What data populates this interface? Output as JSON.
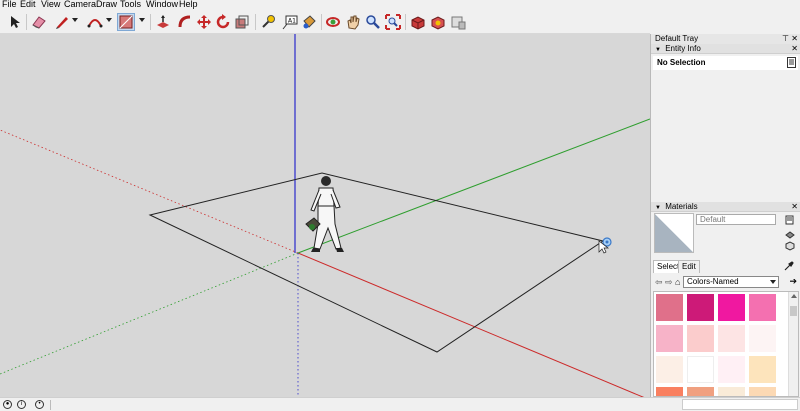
{
  "menu": [
    "File",
    "Edit",
    "View",
    "Camera",
    "Draw",
    "Tools",
    "Window",
    "Help"
  ],
  "toolbar": {
    "tools": [
      "select",
      "eraser",
      "line",
      "arc",
      "shape",
      "push-pull",
      "move",
      "rotate",
      "scale",
      "offset",
      "tape-measure",
      "text",
      "paint-bucket",
      "orbit",
      "pan",
      "zoom",
      "zoom-extents",
      "3d-warehouse",
      "extension-warehouse",
      "extension-manager"
    ]
  },
  "tray": {
    "title": "Default Tray",
    "pin_icon": "pin-icon",
    "close_icon": "close-icon",
    "entity_info": {
      "header": "Entity Info",
      "selection": "No Selection"
    },
    "materials": {
      "header": "Materials",
      "name": "Default",
      "tabs": [
        "Select",
        "Edit"
      ],
      "collection": "Colors-Named",
      "swatches": [
        "#e0708a",
        "#cd1a78",
        "#f018a0",
        "#f470b0",
        "#f7b3c8",
        "#fbcccc",
        "#fde4e4",
        "#fdf4f4",
        "#fcefe6",
        "#ffffff",
        "#fff0f5",
        "#fde4bc",
        "#f98060",
        "#f0a080",
        "#f9ebd8",
        "#fcd9b4"
      ]
    }
  },
  "viewport": {
    "background": "#d7d7d7",
    "axis_red": "#cc2a2a",
    "axis_green": "#2e9e2e",
    "axis_blue": "#2a2acc"
  },
  "status": {
    "measurements": ""
  }
}
